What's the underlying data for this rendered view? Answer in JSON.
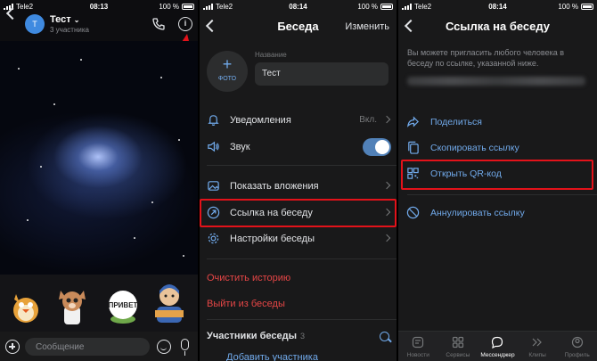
{
  "status": {
    "carrier": "Tele2",
    "battery": "100 %",
    "times": [
      "08:13",
      "08:14",
      "08:14"
    ]
  },
  "chat": {
    "avatar_letter": "Т",
    "title": "Тест",
    "subtitle": "3 участника",
    "input_placeholder": "Сообщение"
  },
  "settings": {
    "title": "Беседа",
    "edit": "Изменить",
    "photo_label": "ФОТО",
    "name_label": "Название",
    "name_value": "Тест",
    "notifications": "Уведомления",
    "notifications_value": "Вкл.",
    "sound": "Звук",
    "sound_on": true,
    "attachments": "Показать вложения",
    "invite_link": "Ссылка на беседу",
    "chat_settings": "Настройки беседы",
    "clear_history": "Очистить историю",
    "leave": "Выйти из беседы",
    "members_title": "Участники беседы",
    "members_count": "3",
    "add_member": "Добавить участника"
  },
  "link_page": {
    "title": "Ссылка на беседу",
    "description": "Вы можете пригласить любого человека в беседу по ссылке, указанной ниже.",
    "share": "Поделиться",
    "copy": "Скопировать ссылку",
    "qr": "Открыть QR-код",
    "revoke": "Аннулировать ссылку"
  },
  "tabs": [
    {
      "label": "Новости",
      "icon": "news-icon"
    },
    {
      "label": "Сервисы",
      "icon": "services-icon"
    },
    {
      "label": "Мессенджер",
      "icon": "messenger-icon",
      "active": true
    },
    {
      "label": "Клипы",
      "icon": "clips-icon"
    },
    {
      "label": "Профиль",
      "icon": "profile-icon"
    }
  ],
  "colors": {
    "accent": "#71aaeb",
    "danger": "#e64646",
    "highlight": "#e3121a",
    "background": "#19191a"
  }
}
